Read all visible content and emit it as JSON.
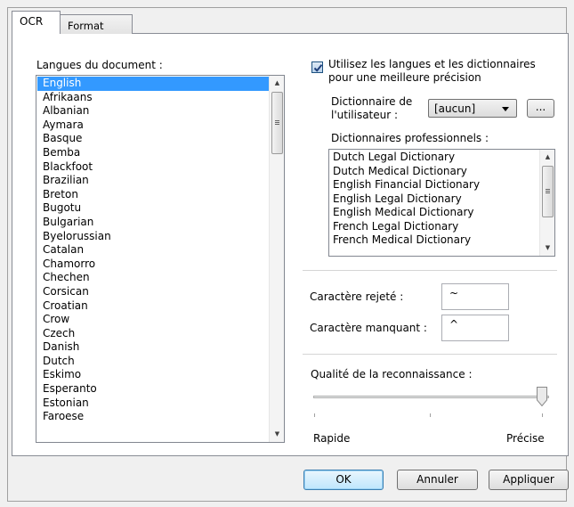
{
  "tabs": [
    {
      "label": "OCR",
      "active": true
    },
    {
      "label": "Format",
      "active": false
    }
  ],
  "languages": {
    "label": "Langues du document :",
    "selected": "English",
    "items": [
      "English",
      "Afrikaans",
      "Albanian",
      "Aymara",
      "Basque",
      "Bemba",
      "Blackfoot",
      "Brazilian",
      "Breton",
      "Bugotu",
      "Bulgarian",
      "Byelorussian",
      "Catalan",
      "Chamorro",
      "Chechen",
      "Corsican",
      "Croatian",
      "Crow",
      "Czech",
      "Danish",
      "Dutch",
      "Eskimo",
      "Esperanto",
      "Estonian",
      "Faroese"
    ]
  },
  "use_dictionaries": {
    "checked": true,
    "label_line1": "Utilisez les langues et les dictionnaires",
    "label_line2": "pour une meilleure précision"
  },
  "user_dictionary": {
    "label_line1": "Dictionnaire de",
    "label_line2": "l'utilisateur :",
    "value": "[aucun]",
    "browse_label": "..."
  },
  "professional_dictionaries": {
    "label": "Dictionnaires professionnels :",
    "items": [
      "Dutch Legal Dictionary",
      "Dutch Medical Dictionary",
      "English Financial Dictionary",
      "English Legal Dictionary",
      "English Medical Dictionary",
      "French Legal Dictionary",
      "French Medical Dictionary"
    ]
  },
  "rejected_char": {
    "label": "Caractère rejeté :",
    "value": "~"
  },
  "missing_char": {
    "label": "Caractère manquant :",
    "value": "^"
  },
  "quality": {
    "label": "Qualité de la reconnaissance :",
    "min_label": "Rapide",
    "max_label": "Précise",
    "level": 1.0
  },
  "footer": {
    "ok": "OK",
    "cancel": "Annuler",
    "apply": "Appliquer"
  }
}
